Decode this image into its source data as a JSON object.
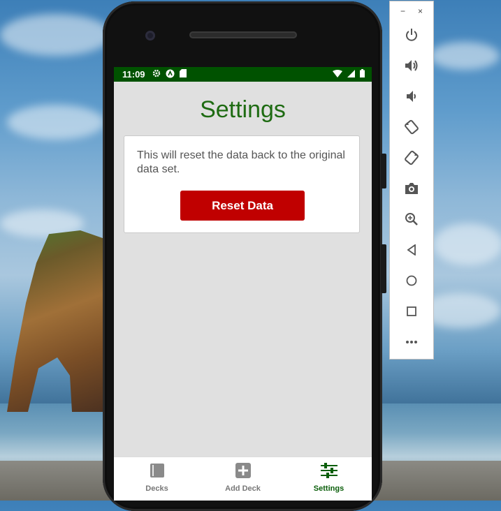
{
  "statusbar": {
    "time": "11:09"
  },
  "screen": {
    "title": "Settings",
    "card_text": "This will reset the data back to the original data set.",
    "reset_button": "Reset Data"
  },
  "bottom_nav": {
    "tabs": [
      {
        "label": "Decks",
        "icon": "book-icon",
        "active": false
      },
      {
        "label": "Add Deck",
        "icon": "plus-square-icon",
        "active": false
      },
      {
        "label": "Settings",
        "icon": "sliders-icon",
        "active": true
      }
    ]
  },
  "emulator_panel": {
    "window_controls": [
      "−",
      "×"
    ],
    "buttons": [
      "power-icon",
      "volume-up-icon",
      "volume-down-icon",
      "rotate-left-icon",
      "rotate-right-icon",
      "camera-icon",
      "zoom-icon",
      "back-icon",
      "home-icon",
      "overview-icon",
      "more-icon"
    ]
  },
  "colors": {
    "status_bar": "#005200",
    "title": "#1e6b12",
    "reset_button": "#c00000",
    "active_tab": "#0a5e0a"
  }
}
